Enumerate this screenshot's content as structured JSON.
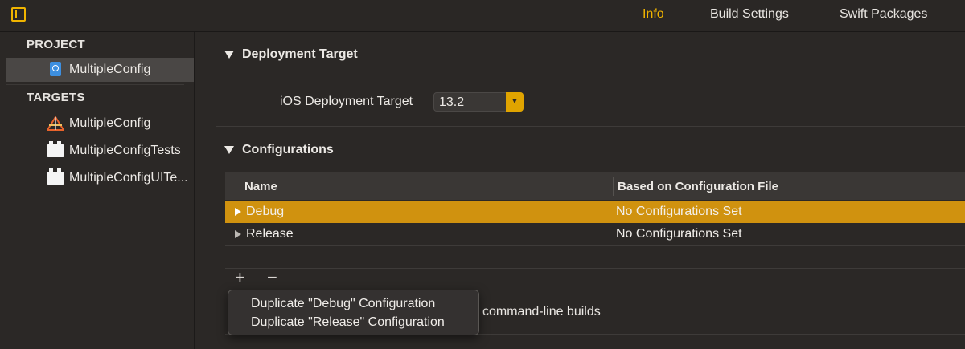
{
  "topbar": {
    "tabs": [
      {
        "label": "Info",
        "active": true
      },
      {
        "label": "Build Settings",
        "active": false
      },
      {
        "label": "Swift Packages",
        "active": false
      }
    ]
  },
  "sidebar": {
    "project_header": "PROJECT",
    "project_item": "MultipleConfig",
    "targets_header": "TARGETS",
    "targets": [
      "MultipleConfig",
      "MultipleConfigTests",
      "MultipleConfigUITe..."
    ]
  },
  "deployment": {
    "title": "Deployment Target",
    "field_label": "iOS Deployment Target",
    "value": "13.2"
  },
  "configurations": {
    "title": "Configurations",
    "columns": [
      "Name",
      "Based on Configuration File"
    ],
    "rows": [
      {
        "name": "Debug",
        "file": "No Configurations Set",
        "selected": true
      },
      {
        "name": "Release",
        "file": "No Configurations Set",
        "selected": false
      }
    ],
    "add_glyph": "+",
    "remove_glyph": "−",
    "partial_text": "command-line builds"
  },
  "menu": {
    "items": [
      "Duplicate \"Debug\" Configuration",
      "Duplicate \"Release\" Configuration"
    ]
  },
  "colors": {
    "accent": "#f0b400",
    "selection": "#d0920f",
    "background": "#2b2826"
  }
}
